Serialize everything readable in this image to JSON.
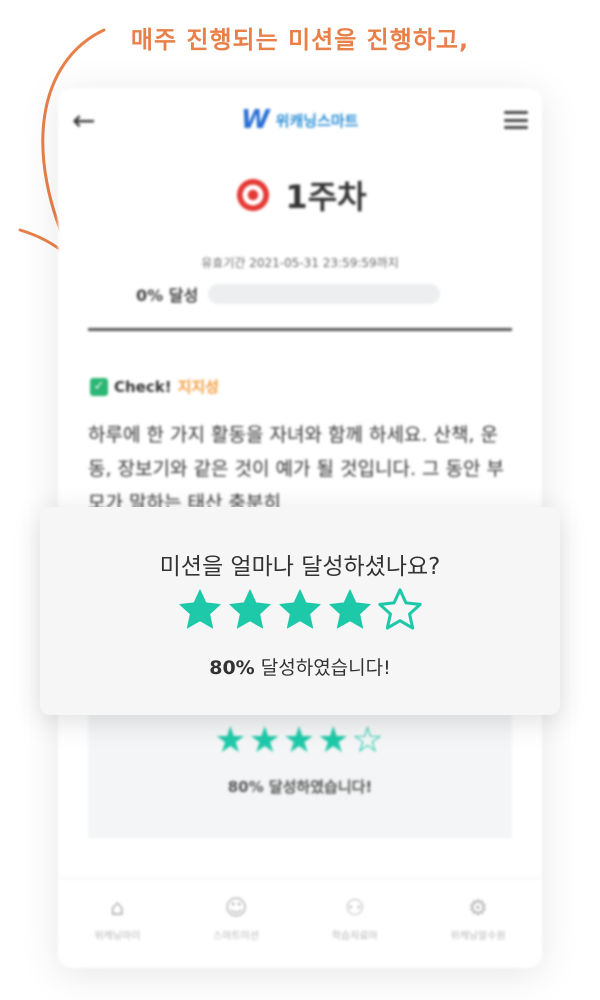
{
  "caption": "매주 진행되는 미션을 진행하고,",
  "app": {
    "logo_mark": "W",
    "logo_text": "위캐닝스마트"
  },
  "mission": {
    "week_title": "1주차",
    "deadline": "유효기간 2021-05-31 23:59:59까지",
    "progress_label": "0% 달성",
    "progress_value": 0,
    "check_label": "Check!",
    "check_tag": "지지성",
    "body_text": "하루에 한 가지 활동을 자녀와 함께 하세요. 산책, 운동, 장보기와 같은 것이 예가 될 것입니다. 그 동안 부모가 말하는 태산 충분히"
  },
  "rating": {
    "question": "미션을 얼마나 달성하셨나요?",
    "stars_filled": 4,
    "stars_total": 5,
    "percent": "80%",
    "result_suffix": " 달성하였습니다!"
  },
  "echo": {
    "percent_text": "80% 달성하였습니다!"
  },
  "bottom_nav": [
    {
      "label": "위캐닝마이",
      "icon": "home-icon"
    },
    {
      "label": "스마트미션",
      "icon": "person-icon"
    },
    {
      "label": "학습자료마",
      "icon": "community-icon"
    },
    {
      "label": "위캐닝알수원",
      "icon": "settings-icon"
    }
  ],
  "colors": {
    "accent": "#1ec9a9",
    "caption": "#e8804a",
    "tag": "#f39c3b"
  }
}
